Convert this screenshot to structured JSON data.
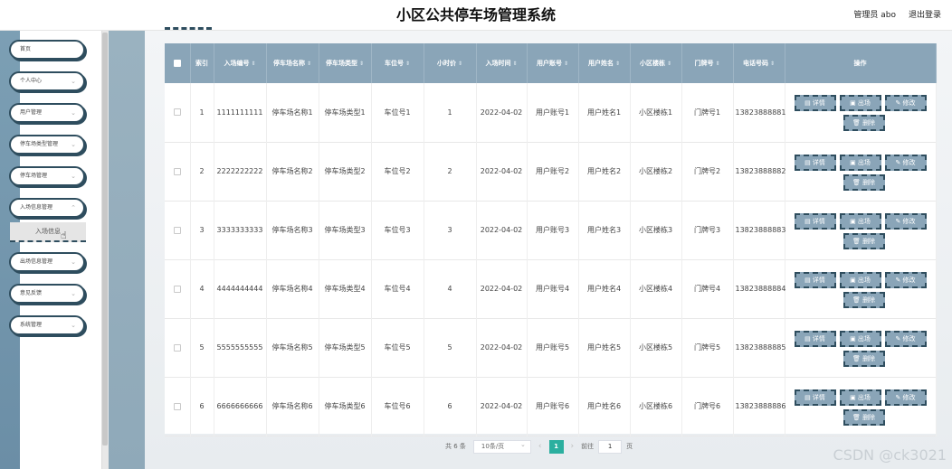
{
  "header": {
    "title": "小区公共停车场管理系统",
    "user": "管理员 abo",
    "logout": "退出登录"
  },
  "sidebar": {
    "items": [
      {
        "label": "首页"
      },
      {
        "label": "个人中心"
      },
      {
        "label": "用户管理"
      },
      {
        "label": "停车场类型管理"
      },
      {
        "label": "停车场管理"
      },
      {
        "label": "入场信息管理"
      },
      {
        "label": "出场信息管理"
      },
      {
        "label": "意见反馈"
      },
      {
        "label": "系统管理"
      }
    ],
    "submenu_label": "入场信息"
  },
  "table": {
    "columns": [
      "索引",
      "入场编号",
      "停车场名称",
      "停车场类型",
      "车位号",
      "小时价",
      "入场时间",
      "用户账号",
      "用户姓名",
      "小区楼栋",
      "门牌号",
      "电话号码",
      "操作"
    ],
    "rows": [
      [
        "1",
        "1111111111",
        "停车场名称1",
        "停车场类型1",
        "车位号1",
        "1",
        "2022-04-02",
        "用户账号1",
        "用户姓名1",
        "小区楼栋1",
        "门牌号1",
        "13823888881"
      ],
      [
        "2",
        "2222222222",
        "停车场名称2",
        "停车场类型2",
        "车位号2",
        "2",
        "2022-04-02",
        "用户账号2",
        "用户姓名2",
        "小区楼栋2",
        "门牌号2",
        "13823888882"
      ],
      [
        "3",
        "3333333333",
        "停车场名称3",
        "停车场类型3",
        "车位号3",
        "3",
        "2022-04-02",
        "用户账号3",
        "用户姓名3",
        "小区楼栋3",
        "门牌号3",
        "13823888883"
      ],
      [
        "4",
        "4444444444",
        "停车场名称4",
        "停车场类型4",
        "车位号4",
        "4",
        "2022-04-02",
        "用户账号4",
        "用户姓名4",
        "小区楼栋4",
        "门牌号4",
        "13823888884"
      ],
      [
        "5",
        "5555555555",
        "停车场名称5",
        "停车场类型5",
        "车位号5",
        "5",
        "2022-04-02",
        "用户账号5",
        "用户姓名5",
        "小区楼栋5",
        "门牌号5",
        "13823888885"
      ],
      [
        "6",
        "6666666666",
        "停车场名称6",
        "停车场类型6",
        "车位号6",
        "6",
        "2022-04-02",
        "用户账号6",
        "用户姓名6",
        "小区楼栋6",
        "门牌号6",
        "13823888886"
      ]
    ],
    "actions": {
      "detail": "详情",
      "exit": "出场",
      "edit": "修改",
      "delete": "删除"
    }
  },
  "pagination": {
    "total": "共 6 条",
    "page_size": "10条/页",
    "current_page": "1",
    "goto_prefix": "前往",
    "goto_value": "1",
    "goto_suffix": "页"
  },
  "watermark": "CSDN @ck3021",
  "colors": {
    "header_bg": "#8aa5b8",
    "accent_dark": "#2e4d5e",
    "page_active": "#2baf9f"
  }
}
